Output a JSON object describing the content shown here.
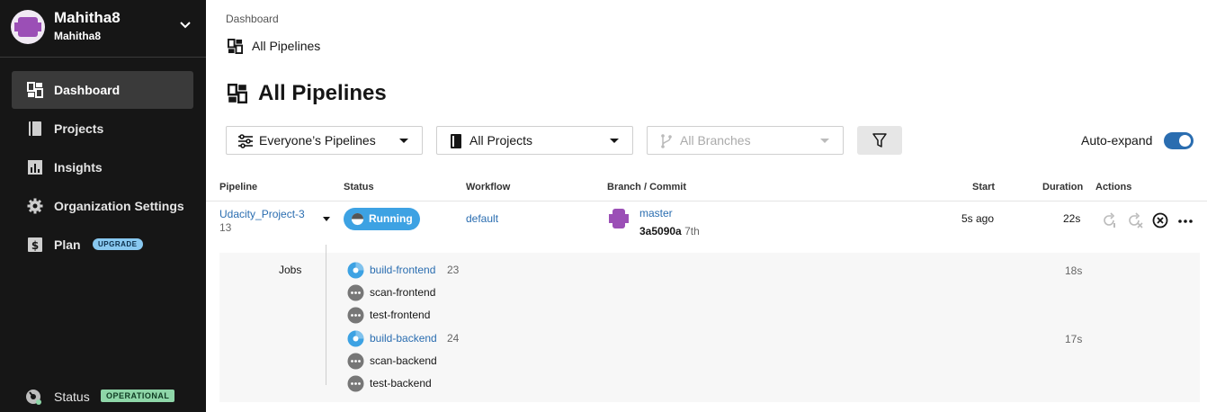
{
  "org": {
    "name": "Mahitha8",
    "sub": "Mahitha8"
  },
  "nav": [
    {
      "label": "Dashboard",
      "icon": "dashboard-icon",
      "active": true
    },
    {
      "label": "Projects",
      "icon": "book-icon"
    },
    {
      "label": "Insights",
      "icon": "bar-chart-icon"
    },
    {
      "label": "Organization Settings",
      "icon": "gear-icon"
    },
    {
      "label": "Plan",
      "icon": "dollar-icon",
      "badge": "UPGRADE"
    }
  ],
  "status": {
    "label": "Status",
    "badge": "OPERATIONAL"
  },
  "breadcrumb": {
    "root": "Dashboard",
    "current": "All Pipelines"
  },
  "page_title": "All Pipelines",
  "filters": {
    "pipelines": "Everyone’s Pipelines",
    "projects": "All Projects",
    "branches": "All Branches"
  },
  "auto_expand": {
    "label": "Auto-expand",
    "on": true
  },
  "table": {
    "headers": {
      "pipeline": "Pipeline",
      "status": "Status",
      "workflow": "Workflow",
      "branch": "Branch / Commit",
      "start": "Start",
      "duration": "Duration",
      "actions": "Actions"
    },
    "row": {
      "pipeline": "Udacity_Project-3",
      "number": "13",
      "status": "Running",
      "workflow": "default",
      "branch": "master",
      "commit": "3a5090a",
      "commit_suffix": "7th",
      "start": "5s ago",
      "duration": "22s"
    },
    "jobs_label": "Jobs",
    "jobs": [
      {
        "name": "build-frontend",
        "num": "23",
        "duration": "18s",
        "state": "running"
      },
      {
        "name": "scan-frontend",
        "num": "",
        "duration": "",
        "state": "waiting"
      },
      {
        "name": "test-frontend",
        "num": "",
        "duration": "",
        "state": "waiting"
      },
      {
        "name": "build-backend",
        "num": "24",
        "duration": "17s",
        "state": "running"
      },
      {
        "name": "scan-backend",
        "num": "",
        "duration": "",
        "state": "waiting"
      },
      {
        "name": "test-backend",
        "num": "",
        "duration": "",
        "state": "waiting"
      }
    ]
  },
  "colors": {
    "accent": "#2a6db0",
    "running": "#3da2e3",
    "sidebar": "#161616",
    "upgrade": "#88c8f0",
    "operational": "#8ed6a8"
  }
}
